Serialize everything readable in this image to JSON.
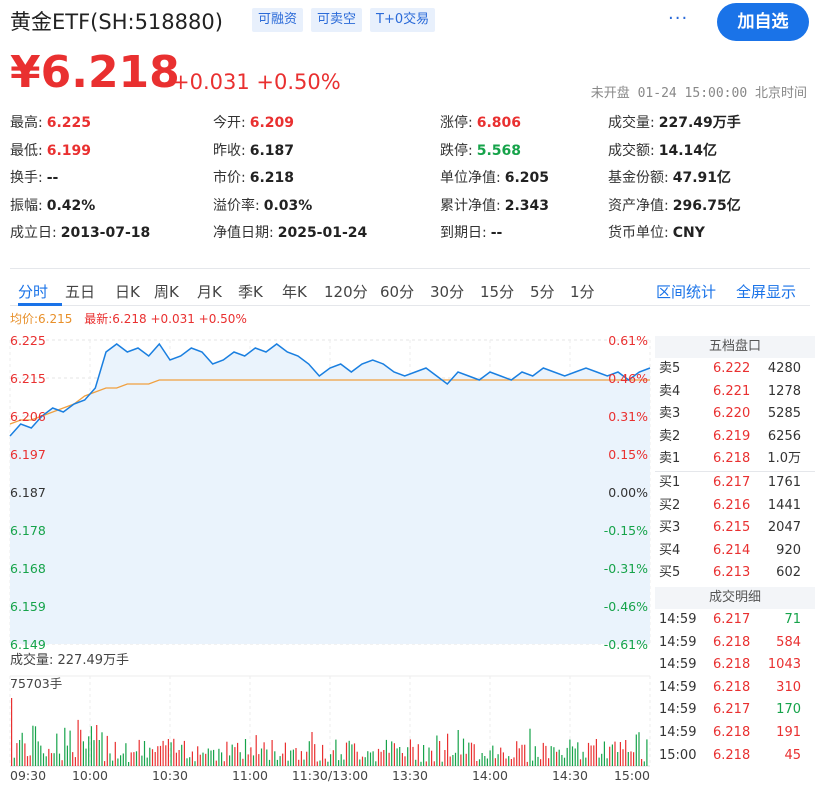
{
  "header": {
    "title": "黄金ETF(SH:518880)",
    "tags": [
      "可融资",
      "可卖空",
      "T+0交易"
    ],
    "more": "···",
    "add_button": "加自选"
  },
  "price": {
    "last": "¥6.218",
    "change": "+0.031 +0.50%",
    "status": "未开盘 01-24 15:00:00 北京时间"
  },
  "quote": [
    [
      {
        "label": "最高:",
        "value": "6.225",
        "color": "red"
      },
      {
        "label": "今开:",
        "value": "6.209",
        "color": "red"
      },
      {
        "label": "涨停:",
        "value": "6.806",
        "color": "red"
      },
      {
        "label": "成交量:",
        "value": "227.49万手",
        "color": "black"
      }
    ],
    [
      {
        "label": "最低:",
        "value": "6.199",
        "color": "red"
      },
      {
        "label": "昨收:",
        "value": "6.187",
        "color": "black"
      },
      {
        "label": "跌停:",
        "value": "5.568",
        "color": "green"
      },
      {
        "label": "成交额:",
        "value": "14.14亿",
        "color": "black"
      }
    ],
    [
      {
        "label": "换手:",
        "value": "--",
        "color": "black"
      },
      {
        "label": "市价:",
        "value": "6.218",
        "color": "black"
      },
      {
        "label": "单位净值:",
        "value": "6.205",
        "color": "black"
      },
      {
        "label": "基金份额:",
        "value": "47.91亿",
        "color": "black"
      }
    ],
    [
      {
        "label": "振幅:",
        "value": "0.42%",
        "color": "black"
      },
      {
        "label": "溢价率:",
        "value": "0.03%",
        "color": "black"
      },
      {
        "label": "累计净值:",
        "value": "2.343",
        "color": "black"
      },
      {
        "label": "资产净值:",
        "value": "296.75亿",
        "color": "black"
      }
    ],
    [
      {
        "label": "成立日:",
        "value": "2013-07-18",
        "color": "black"
      },
      {
        "label": "净值日期:",
        "value": "2025-01-24",
        "color": "black"
      },
      {
        "label": "到期日:",
        "value": "--",
        "color": "black"
      },
      {
        "label": "货币单位:",
        "value": "CNY",
        "color": "black"
      }
    ]
  ],
  "tabs": [
    "分时",
    "五日",
    "日K",
    "周K",
    "月K",
    "季K",
    "年K",
    "120分",
    "60分",
    "30分",
    "15分",
    "5分",
    "1分"
  ],
  "tabs_right": [
    "区间统计",
    "全屏显示"
  ],
  "chart_info": {
    "avg_label": "均价:6.215",
    "latest_label": "最新:6.218 +0.031 +0.50%",
    "volume_label": "成交量: 227.49万手",
    "max_volume_label": "75703手"
  },
  "chart_data": {
    "type": "line",
    "y_ticks": [
      "6.225",
      "6.215",
      "6.206",
      "6.197",
      "6.187",
      "6.178",
      "6.168",
      "6.159",
      "6.149"
    ],
    "pct_ticks": [
      "0.61%",
      "0.46%",
      "0.31%",
      "0.15%",
      "0.00%",
      "-0.15%",
      "-0.31%",
      "-0.46%",
      "-0.61%"
    ],
    "x_ticks": [
      "09:30",
      "10:00",
      "10:30",
      "11:00",
      "11:30/13:00",
      "13:30",
      "14:00",
      "14:30",
      "15:00"
    ],
    "ylim": [
      6.149,
      6.225
    ],
    "prev_close": 6.187,
    "series": [
      {
        "name": "最新",
        "values": [
          6.201,
          6.204,
          6.203,
          6.206,
          6.208,
          6.207,
          6.209,
          6.21,
          6.213,
          6.222,
          6.224,
          6.222,
          6.223,
          6.221,
          6.224,
          6.22,
          6.221,
          6.223,
          6.222,
          6.219,
          6.22,
          6.222,
          6.221,
          6.223,
          6.222,
          6.224,
          6.222,
          6.221,
          6.219,
          6.216,
          6.218,
          6.219,
          6.217,
          6.219,
          6.22,
          6.219,
          6.217,
          6.216,
          6.217,
          6.218,
          6.216,
          6.214,
          6.217,
          6.216,
          6.215,
          6.217,
          6.216,
          6.215,
          6.217,
          6.216,
          6.218,
          6.217,
          6.216,
          6.217,
          6.218,
          6.217,
          6.216,
          6.217,
          6.215,
          6.217,
          6.218
        ]
      },
      {
        "name": "均价",
        "values": [
          6.204,
          6.205,
          6.205,
          6.206,
          6.207,
          6.208,
          6.209,
          6.211,
          6.212,
          6.213,
          6.213,
          6.214,
          6.214,
          6.214,
          6.215,
          6.215,
          6.215,
          6.215,
          6.215,
          6.215,
          6.215,
          6.215,
          6.215,
          6.215,
          6.215,
          6.215,
          6.215,
          6.215,
          6.215,
          6.215,
          6.215,
          6.215,
          6.215,
          6.215,
          6.215,
          6.215,
          6.215,
          6.215,
          6.215,
          6.215,
          6.215,
          6.215,
          6.215,
          6.215,
          6.215,
          6.215,
          6.215,
          6.215,
          6.215,
          6.215,
          6.215,
          6.215,
          6.215,
          6.215,
          6.215,
          6.215,
          6.215,
          6.215,
          6.215,
          6.215,
          6.215
        ]
      }
    ]
  },
  "orderbook": {
    "title": "五档盘口",
    "asks": [
      {
        "label": "卖5",
        "price": "6.222",
        "vol": "4280"
      },
      {
        "label": "卖4",
        "price": "6.221",
        "vol": "1278"
      },
      {
        "label": "卖3",
        "price": "6.220",
        "vol": "5285"
      },
      {
        "label": "卖2",
        "price": "6.219",
        "vol": "6256"
      },
      {
        "label": "卖1",
        "price": "6.218",
        "vol": "1.0万"
      }
    ],
    "bids": [
      {
        "label": "买1",
        "price": "6.217",
        "vol": "1761"
      },
      {
        "label": "买2",
        "price": "6.216",
        "vol": "1441"
      },
      {
        "label": "买3",
        "price": "6.215",
        "vol": "2047"
      },
      {
        "label": "买4",
        "price": "6.214",
        "vol": "920"
      },
      {
        "label": "买5",
        "price": "6.213",
        "vol": "602"
      }
    ],
    "trades_title": "成交明细",
    "trades": [
      {
        "time": "14:59",
        "price": "6.217",
        "vol": "71",
        "color": "green"
      },
      {
        "time": "14:59",
        "price": "6.218",
        "vol": "584",
        "color": "red"
      },
      {
        "time": "14:59",
        "price": "6.218",
        "vol": "1043",
        "color": "red"
      },
      {
        "time": "14:59",
        "price": "6.218",
        "vol": "310",
        "color": "red"
      },
      {
        "time": "14:59",
        "price": "6.217",
        "vol": "170",
        "color": "green"
      },
      {
        "time": "14:59",
        "price": "6.218",
        "vol": "191",
        "color": "red"
      },
      {
        "time": "15:00",
        "price": "6.218",
        "vol": "45",
        "color": "red"
      }
    ]
  }
}
